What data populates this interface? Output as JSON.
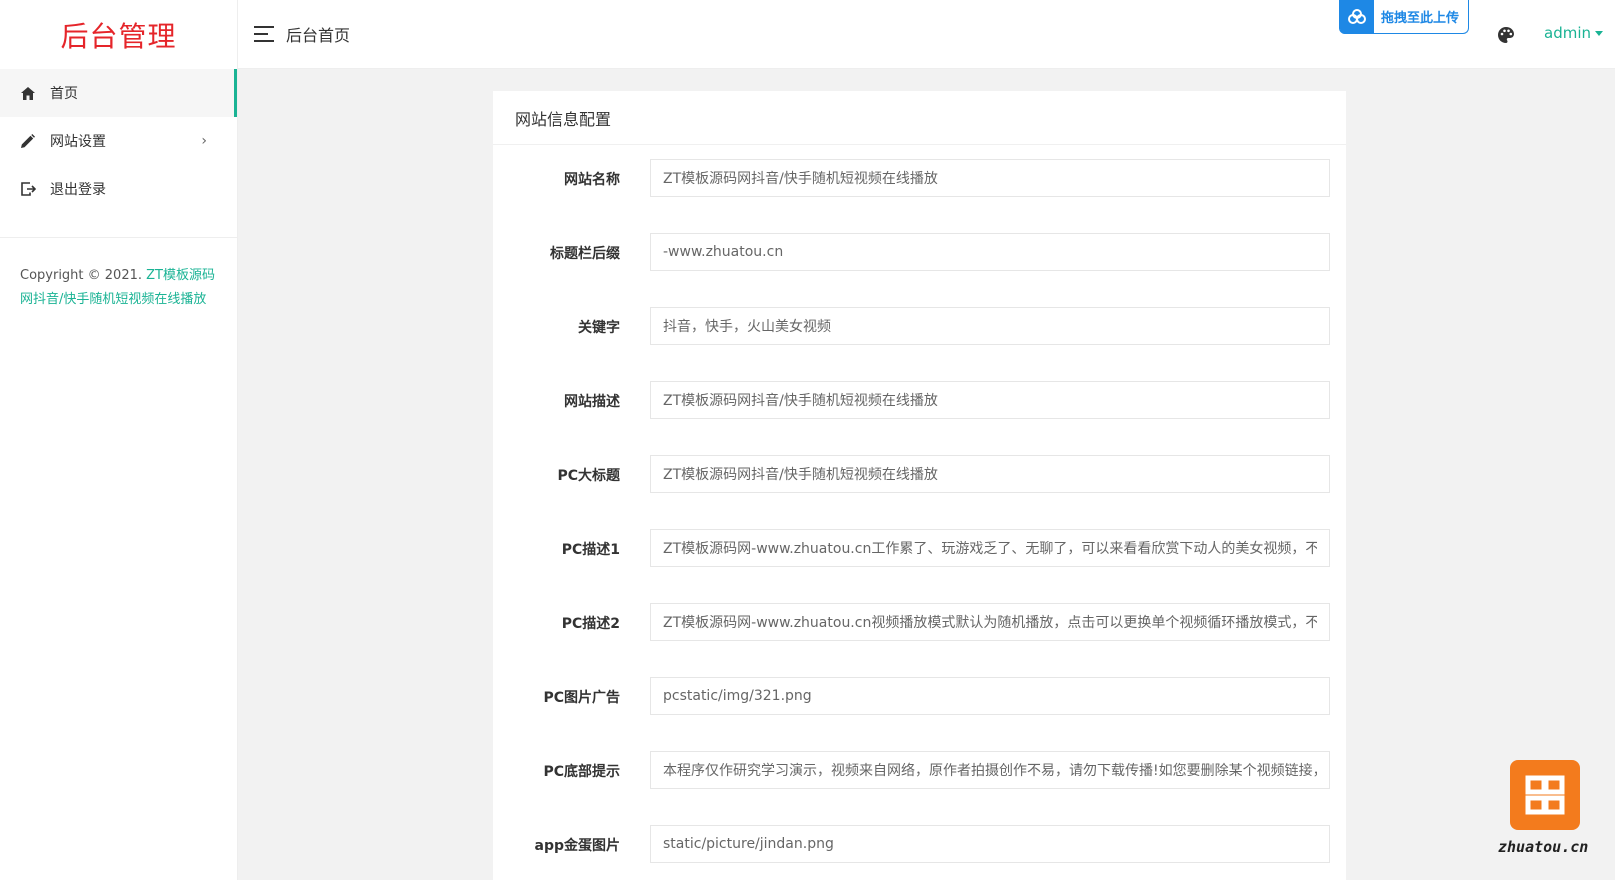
{
  "sidebar": {
    "logo": "后台管理",
    "items": [
      {
        "label": "首页",
        "icon": "home-icon"
      },
      {
        "label": "网站设置",
        "icon": "pencil-icon"
      },
      {
        "label": "退出登录",
        "icon": "logout-icon"
      }
    ],
    "copyright_prefix": "Copyright © 2021. ",
    "copyright_link": "ZT模板源码网抖音/快手随机短视频在线播放"
  },
  "header": {
    "title": "后台首页",
    "upload_label": "拖拽至此上传",
    "user": "admin"
  },
  "card": {
    "title": "网站信息配置",
    "fields": [
      {
        "label": "网站名称",
        "value": "ZT模板源码网抖音/快手随机短视频在线播放"
      },
      {
        "label": "标题栏后缀",
        "value": "-www.zhuatou.cn"
      },
      {
        "label": "关键字",
        "value": "抖音，快手，火山美女视频"
      },
      {
        "label": "网站描述",
        "value": "ZT模板源码网抖音/快手随机短视频在线播放"
      },
      {
        "label": "PC大标题",
        "value": "ZT模板源码网抖音/快手随机短视频在线播放"
      },
      {
        "label": "PC描述1",
        "value": "ZT模板源码网-www.zhuatou.cn工作累了、玩游戏乏了、无聊了，可以来看看欣赏下动人的美女视频，不仅"
      },
      {
        "label": "PC描述2",
        "value": "ZT模板源码网-www.zhuatou.cn视频播放模式默认为随机播放，点击可以更换单个视频循环播放模式，不要"
      },
      {
        "label": "PC图片广告",
        "value": "pcstatic/img/321.png"
      },
      {
        "label": "PC底部提示",
        "value": "本程序仅作研究学习演示，视频来自网络，原作者拍摄创作不易，请勿下载传播!如您要删除某个视频链接，"
      },
      {
        "label": "app金蛋图片",
        "value": "static/picture/jindan.png"
      }
    ]
  },
  "watermark": {
    "site": "zhuatou.cn"
  }
}
